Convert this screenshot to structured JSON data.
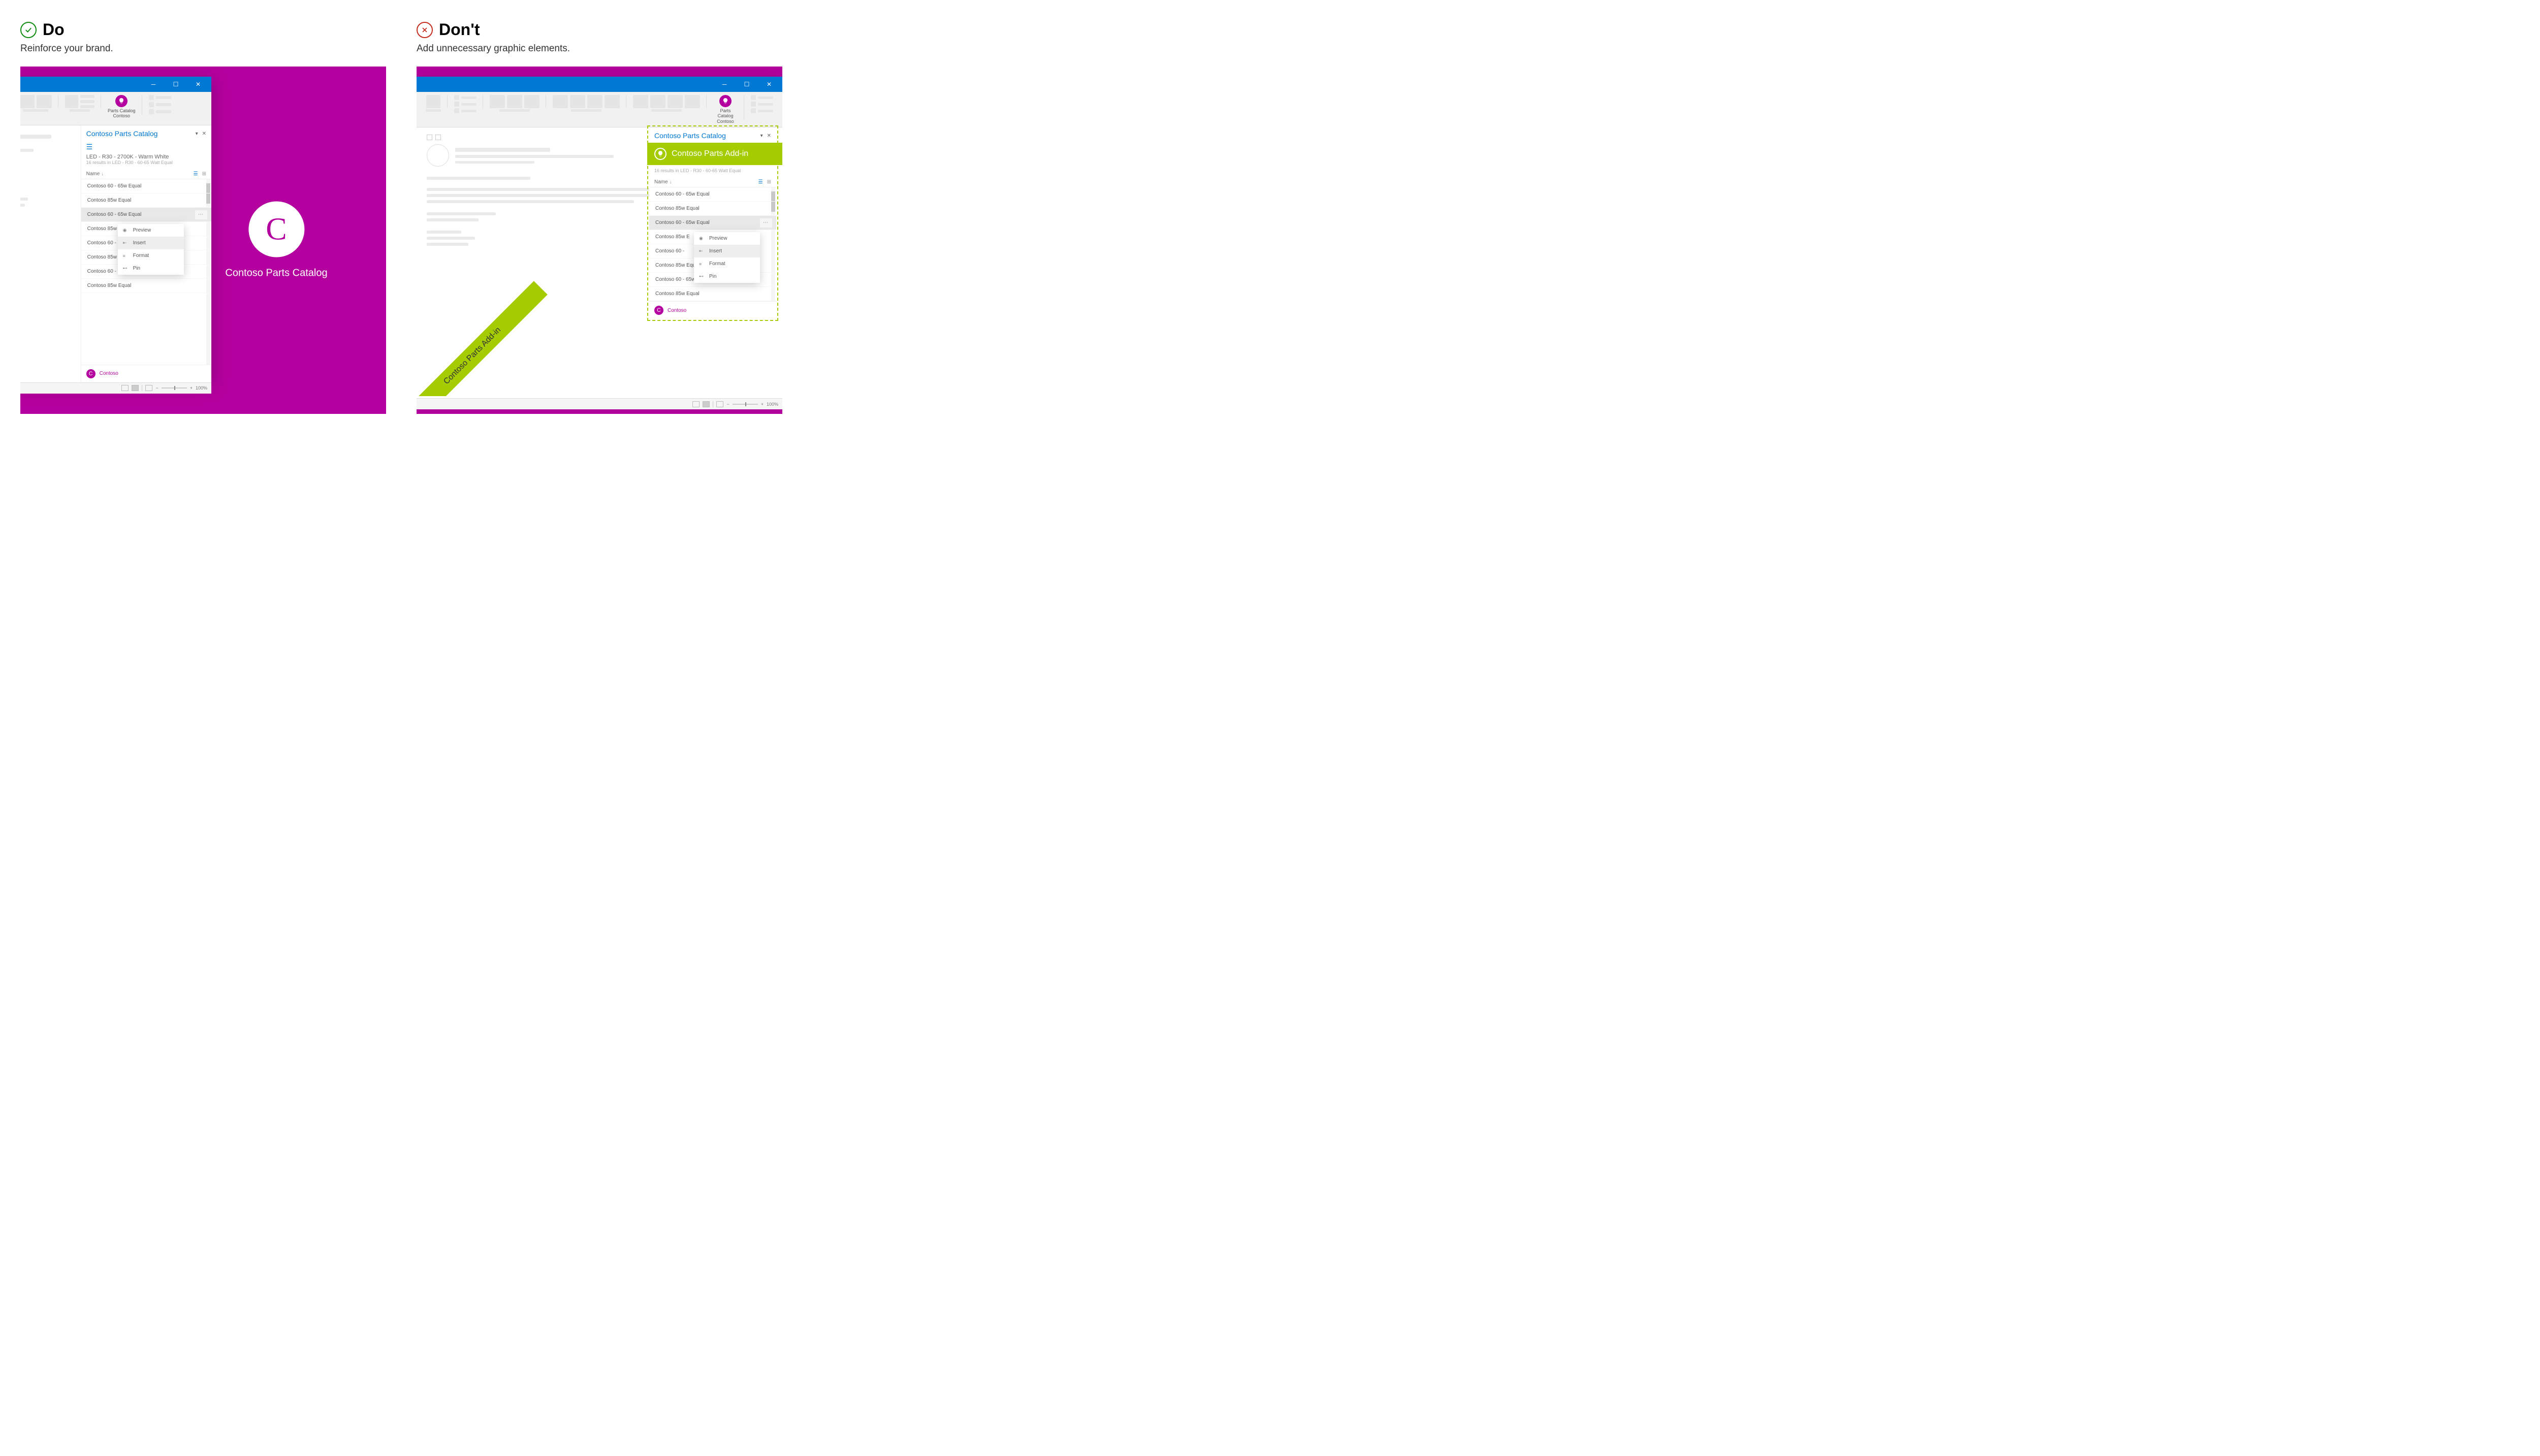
{
  "do": {
    "title": "Do",
    "subtitle": "Reinforce your brand."
  },
  "dont": {
    "title": "Don't",
    "subtitle": "Add unnecessary graphic elements."
  },
  "ribbon": {
    "addin_name": "Parts Catalog",
    "addin_vendor": "Contoso"
  },
  "taskpane": {
    "title": "Contoso Parts Catalog",
    "search_label": "LED - R30 - 2700K - Warm White",
    "search_sub": "16 results in LED - R30 - 60-65 Watt Equal",
    "column_name": "Name",
    "items": [
      "Contoso 60 - 65w Equal",
      "Contoso 85w Equal",
      "Contoso 60 - 65w Equal",
      "Contoso 85w Equal",
      "Contoso 60 - 65w Equal",
      "Contoso 85w Equal",
      "Contoso 60 - 65w Equal",
      "Contoso 85w Equal"
    ],
    "selected_index": 2,
    "footer_brand": "Contoso"
  },
  "context_menu": {
    "items": [
      "Preview",
      "Insert",
      "Format",
      "Pin"
    ],
    "hover_index": 1
  },
  "statusbar": {
    "zoom": "100%"
  },
  "brand_hero": {
    "letter": "C",
    "label": "Contoso Parts Catalog"
  },
  "dont_banner": "Contoso Parts Add-in",
  "dont_corner_ribbon": "Contoso Parts Add-in"
}
